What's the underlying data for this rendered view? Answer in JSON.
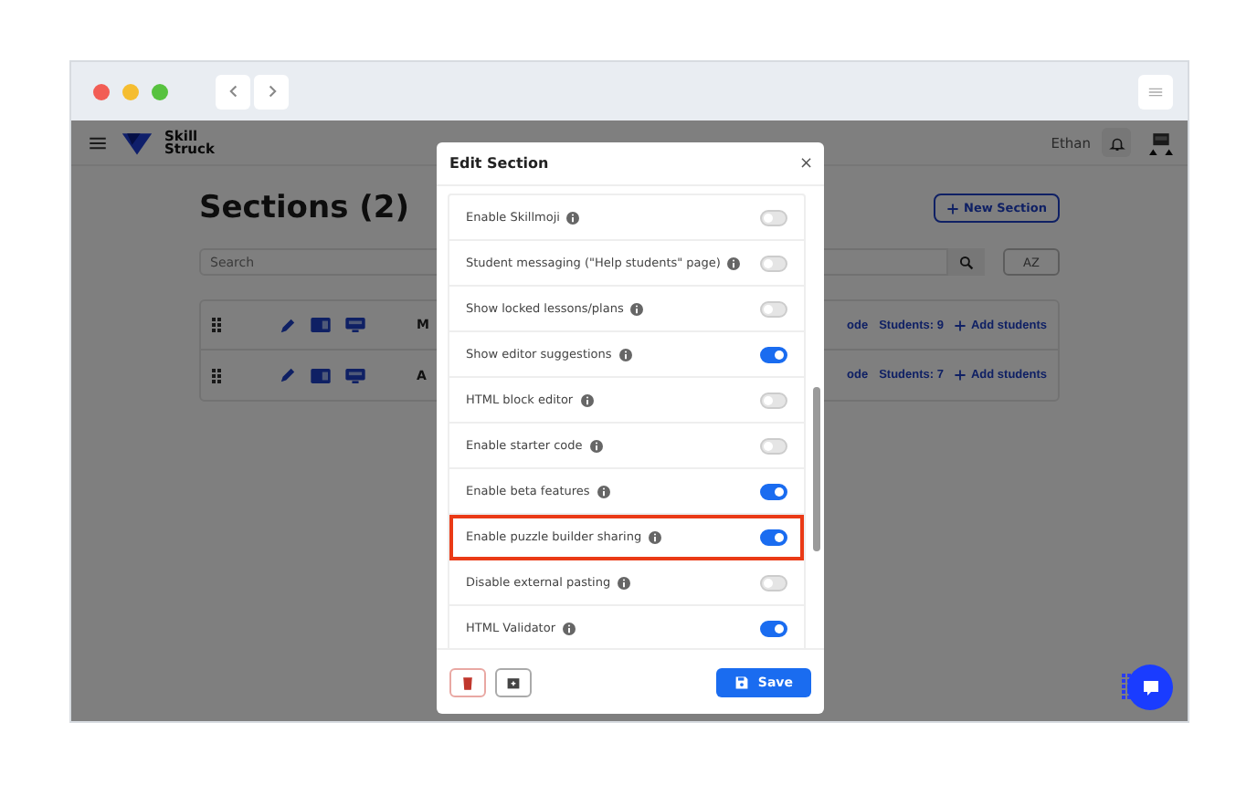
{
  "app": {
    "user": "Ethan",
    "logo_text": "Skill Struck",
    "page_title": "Sections (2)",
    "new_section_label": "New Section",
    "search": {
      "placeholder": "Search"
    },
    "sort_label": "AZ",
    "rows": [
      {
        "name": "M",
        "code": "ode",
        "students": "Students: 9",
        "add_label": "Add students"
      },
      {
        "name": "A",
        "code": "ode",
        "students": "Students: 7",
        "add_label": "Add students"
      }
    ]
  },
  "modal": {
    "title": "Edit Section",
    "close": "×",
    "settings": [
      {
        "label": "Enable Skillmoji",
        "on": false,
        "highlighted": false
      },
      {
        "label": "Student messaging (\"Help students\" page)",
        "on": false,
        "highlighted": false
      },
      {
        "label": "Show locked lessons/plans",
        "on": false,
        "highlighted": false
      },
      {
        "label": "Show editor suggestions",
        "on": true,
        "highlighted": false
      },
      {
        "label": "HTML block editor",
        "on": false,
        "highlighted": false
      },
      {
        "label": "Enable starter code",
        "on": false,
        "highlighted": false
      },
      {
        "label": "Enable beta features",
        "on": true,
        "highlighted": false
      },
      {
        "label": "Enable puzzle builder sharing",
        "on": true,
        "highlighted": true
      },
      {
        "label": "Disable external pasting",
        "on": false,
        "highlighted": false
      },
      {
        "label": "HTML Validator",
        "on": true,
        "highlighted": false
      }
    ],
    "save_label": "Save"
  }
}
